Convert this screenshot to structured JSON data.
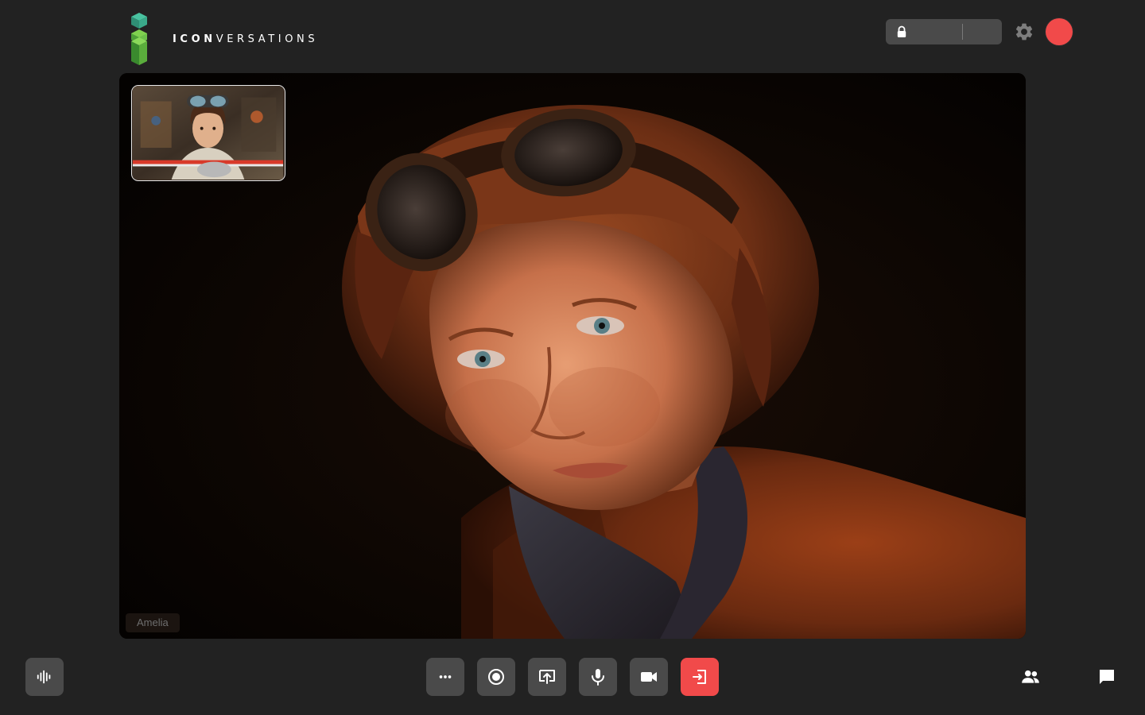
{
  "app": {
    "logo_bold": "ICON",
    "logo_light": "VERSATIONS",
    "logo_colors": [
      "#3aa98a",
      "#6cc04a",
      "#2e7d32"
    ]
  },
  "header": {
    "room_code": "",
    "lock_icon": "lock-icon",
    "settings_icon": "gear-icon",
    "record_indicator_color": "#f14a4a"
  },
  "stage": {
    "participant_name": "Amelia"
  },
  "controls": {
    "left": [
      {
        "name": "audio-visualizer",
        "icon": "audio-wave-icon"
      }
    ],
    "center": [
      {
        "name": "more-options",
        "icon": "more-horizontal-icon"
      },
      {
        "name": "record",
        "icon": "record-icon"
      },
      {
        "name": "share-screen",
        "icon": "screen-share-icon"
      },
      {
        "name": "microphone",
        "icon": "microphone-icon"
      },
      {
        "name": "camera",
        "icon": "video-camera-icon"
      },
      {
        "name": "leave-call",
        "icon": "exit-icon",
        "color": "#f14a4a"
      }
    ],
    "right": [
      {
        "name": "participants",
        "icon": "people-icon"
      },
      {
        "name": "chat",
        "icon": "chat-bubble-icon"
      }
    ]
  },
  "colors": {
    "background": "#222222",
    "button": "#4a4a4a",
    "danger": "#f14a4a"
  }
}
